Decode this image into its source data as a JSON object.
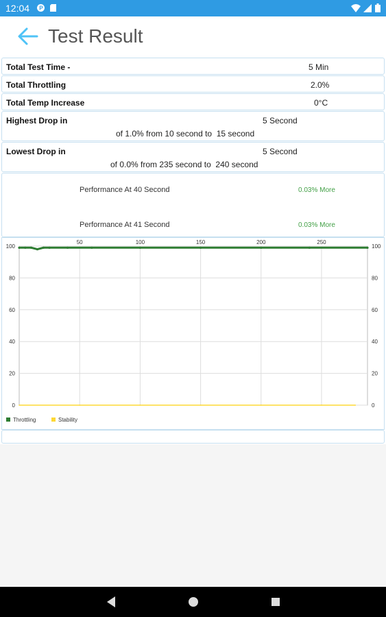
{
  "status_bar": {
    "time": "12:04",
    "icons": [
      "app-notification-icon",
      "sd-card-icon",
      "wifi-icon",
      "signal-icon",
      "battery-icon"
    ]
  },
  "app_bar": {
    "back_icon": "arrow-back-icon",
    "title": "Test Result",
    "accent_color": "#4fc3f7"
  },
  "summary": {
    "total_test_time": {
      "label": "Total Test Time -",
      "value": "5 Min"
    },
    "total_throttling": {
      "label": "Total Throttling",
      "value": "2.0%"
    },
    "total_temp_increase": {
      "label": "Total Temp Increase",
      "value": "0°C"
    },
    "highest_drop": {
      "label": "Highest Drop in",
      "value": "5 Second",
      "detail": "of 1.0% from 10 second to  15 second"
    },
    "lowest_drop": {
      "label": "Lowest Drop in",
      "value": "5 Second",
      "detail": "of 0.0% from 235 second to  240 second"
    }
  },
  "performance": [
    {
      "label": "Performance At 40 Second",
      "value": "0.03% More"
    },
    {
      "label": "Performance At 41 Second",
      "value": "0.03% More"
    }
  ],
  "chart_data": {
    "type": "line",
    "x_ticks": [
      50,
      100,
      150,
      200,
      250
    ],
    "x_tick_labels": [
      "50",
      "100",
      "150",
      "200",
      "250"
    ],
    "xlim": [
      0,
      288
    ],
    "ylim": [
      0,
      100
    ],
    "y_ticks": [
      0,
      20,
      40,
      60,
      80,
      100
    ],
    "y_tick_labels": [
      "0",
      "20",
      "40",
      "60",
      "80",
      "100"
    ],
    "grid": true,
    "legend_position": "bottom-left",
    "series": [
      {
        "name": "Throttling",
        "color": "#2e7d32",
        "x": [
          0,
          5,
          10,
          15,
          20,
          25,
          40,
          60,
          100,
          150,
          200,
          240,
          288
        ],
        "y": [
          99,
          99,
          99,
          98,
          99,
          99,
          99,
          99,
          99,
          99,
          99,
          99,
          99
        ]
      },
      {
        "name": "Stability",
        "color": "#fdd835",
        "x": [
          0,
          50,
          100,
          150,
          200,
          250,
          278
        ],
        "y": [
          0,
          0,
          0,
          0,
          0,
          0,
          0
        ]
      }
    ]
  },
  "nav_bar": {
    "icons": [
      "back-triangle-icon",
      "home-circle-icon",
      "recents-square-icon"
    ]
  }
}
